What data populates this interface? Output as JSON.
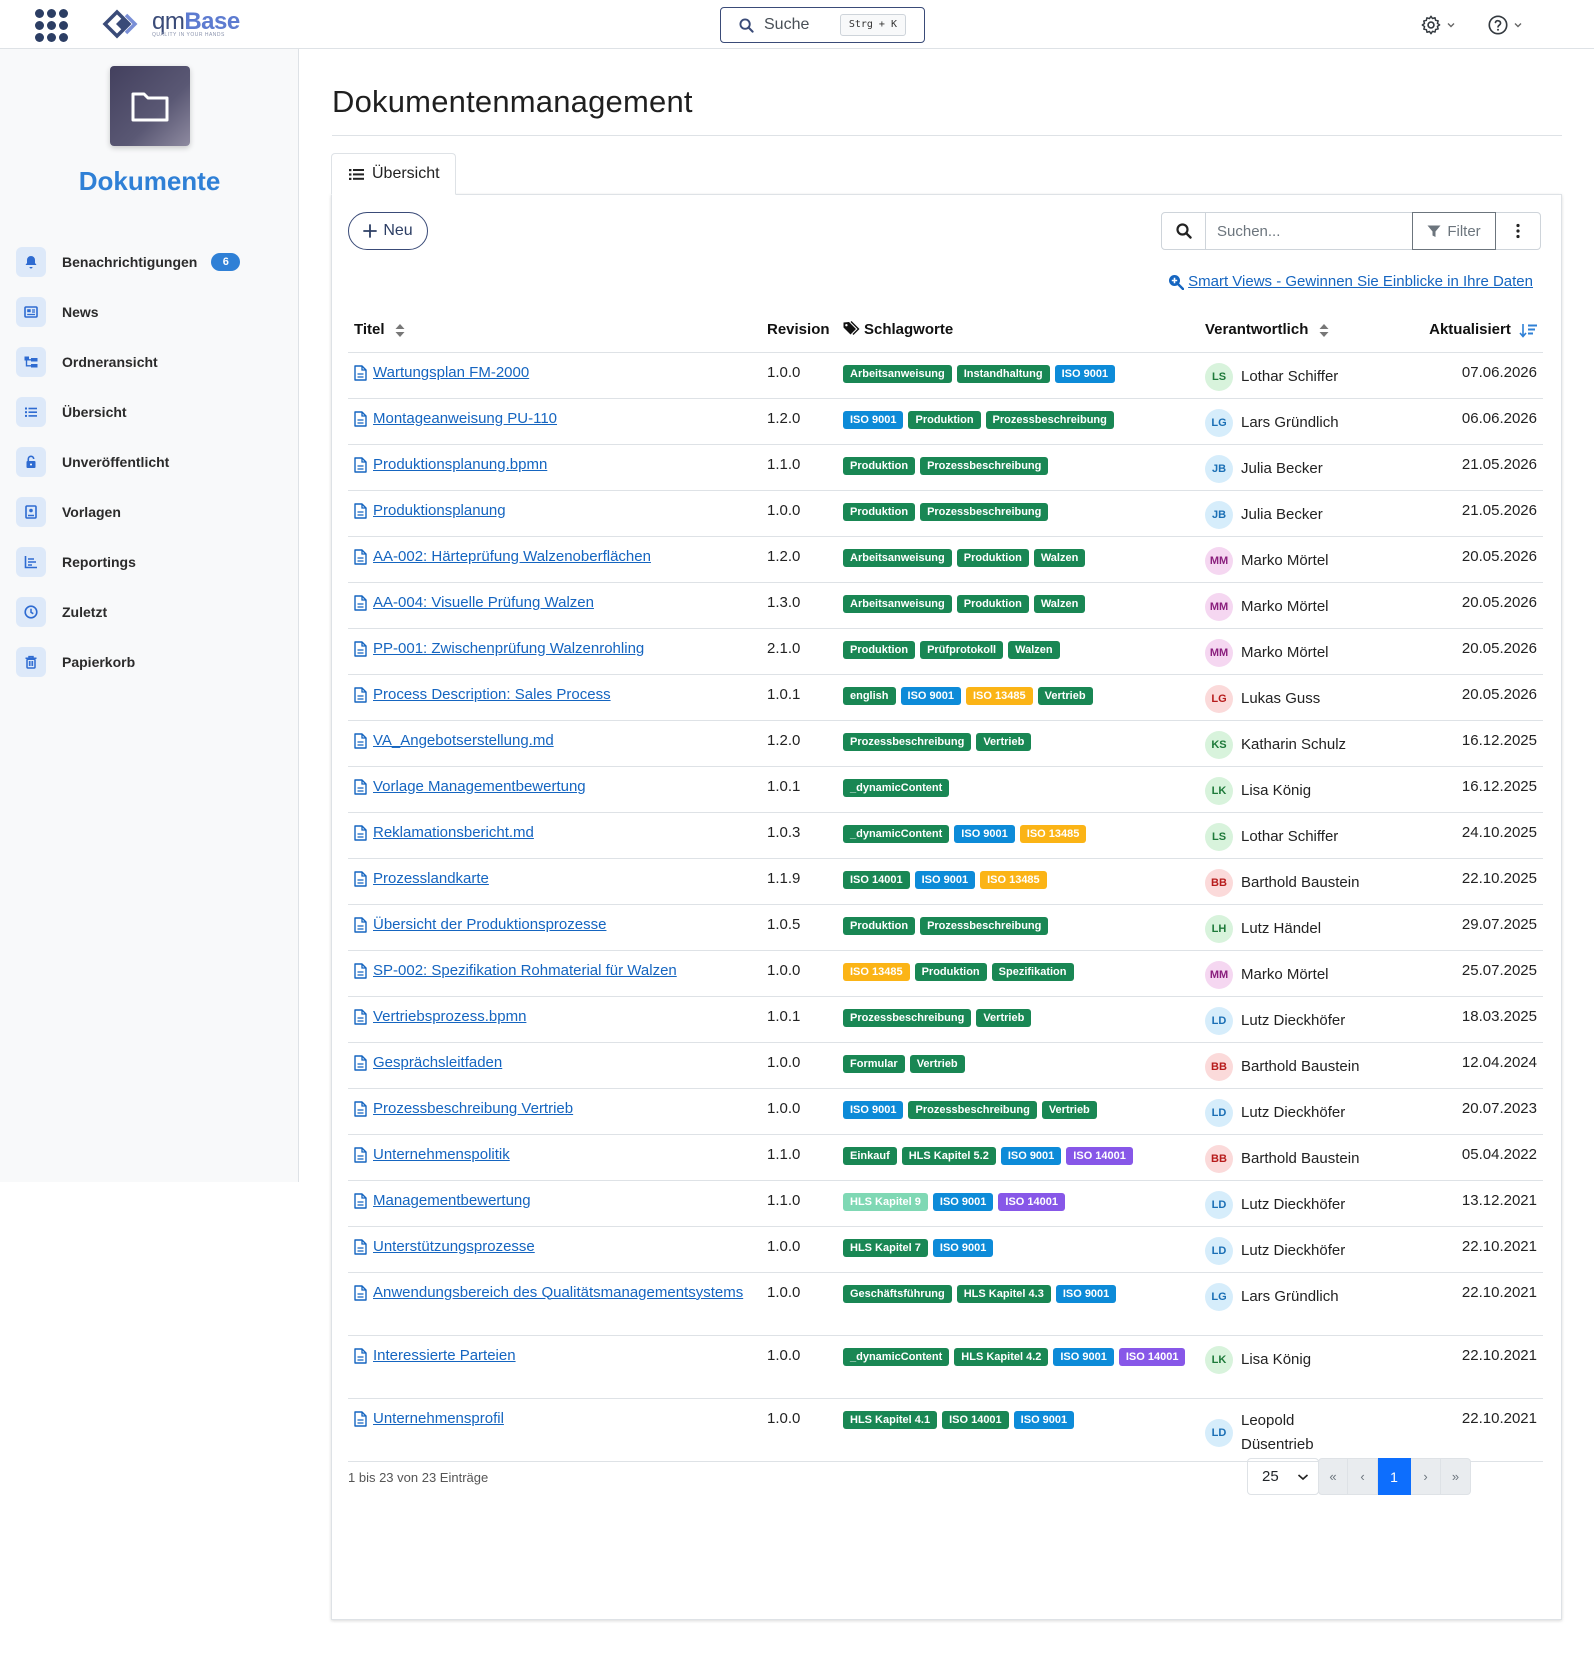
{
  "header": {
    "logo_main": "qm",
    "logo_accent": "Base",
    "logo_sub": "QUALITY IN YOUR HANDS",
    "search_label": "Suche",
    "search_shortcut": "Strg + K"
  },
  "sidebar": {
    "title": "Dokumente",
    "items": [
      {
        "label": "Benachrichtigungen",
        "icon": "bell-icon",
        "badge": "6"
      },
      {
        "label": "News",
        "icon": "newspaper-icon"
      },
      {
        "label": "Ordneransicht",
        "icon": "folder-tree-icon"
      },
      {
        "label": "Übersicht",
        "icon": "list-icon"
      },
      {
        "label": "Unveröffentlicht",
        "icon": "lock-icon"
      },
      {
        "label": "Vorlagen",
        "icon": "template-icon"
      },
      {
        "label": "Reportings",
        "icon": "chart-icon"
      },
      {
        "label": "Zuletzt",
        "icon": "clock-icon"
      },
      {
        "label": "Papierkorb",
        "icon": "trash-icon"
      }
    ]
  },
  "main": {
    "page_title": "Dokumentenmanagement",
    "tab_label": "Übersicht",
    "new_button": "Neu",
    "search_placeholder": "Suchen...",
    "filter_label": "Filter",
    "smart_views_link": "Smart Views - Gewinnen Sie Einblicke in Ihre Daten",
    "columns": {
      "title": "Titel",
      "revision": "Revision",
      "tags": "Schlagworte",
      "owner": "Verantwortlich",
      "updated": "Aktualisiert"
    },
    "tag_colors": {
      "green": "#198754",
      "blue": "#0d8bd8",
      "orange": "#fbb416",
      "purple": "#8757e8",
      "mint": "#7fd8b4"
    },
    "rows": [
      {
        "title": "Wartungsplan FM-2000",
        "rev": "1.0.0",
        "tags": [
          [
            "Arbeitsanweisung",
            "green"
          ],
          [
            "Instandhaltung",
            "green"
          ],
          [
            "ISO 9001",
            "blue"
          ]
        ],
        "initials": "LS",
        "name": "Lothar Schiffer",
        "date": "07.06.2026"
      },
      {
        "title": "Montageanweisung PU-110",
        "rev": "1.2.0",
        "tags": [
          [
            "ISO 9001",
            "blue"
          ],
          [
            "Produktion",
            "green"
          ],
          [
            "Prozessbeschreibung",
            "green"
          ]
        ],
        "initials": "LG",
        "name": "Lars Gründlich",
        "date": "06.06.2026"
      },
      {
        "title": "Produktionsplanung.bpmn",
        "rev": "1.1.0",
        "tags": [
          [
            "Produktion",
            "green"
          ],
          [
            "Prozessbeschreibung",
            "green"
          ]
        ],
        "initials": "JB",
        "name": "Julia Becker",
        "date": "21.05.2026"
      },
      {
        "title": "Produktionsplanung",
        "rev": "1.0.0",
        "tags": [
          [
            "Produktion",
            "green"
          ],
          [
            "Prozessbeschreibung",
            "green"
          ]
        ],
        "initials": "JB",
        "name": "Julia Becker",
        "date": "21.05.2026"
      },
      {
        "title": "AA-002: Härteprüfung Walzenoberflächen",
        "rev": "1.2.0",
        "tags": [
          [
            "Arbeitsanweisung",
            "green"
          ],
          [
            "Produktion",
            "green"
          ],
          [
            "Walzen",
            "green"
          ]
        ],
        "initials": "MM",
        "name": "Marko Mörtel",
        "date": "20.05.2026"
      },
      {
        "title": "AA-004: Visuelle Prüfung Walzen",
        "rev": "1.3.0",
        "tags": [
          [
            "Arbeitsanweisung",
            "green"
          ],
          [
            "Produktion",
            "green"
          ],
          [
            "Walzen",
            "green"
          ]
        ],
        "initials": "MM",
        "name": "Marko Mörtel",
        "date": "20.05.2026"
      },
      {
        "title": "PP-001: Zwischenprüfung Walzenrohling",
        "rev": "2.1.0",
        "tags": [
          [
            "Produktion",
            "green"
          ],
          [
            "Prüfprotokoll",
            "green"
          ],
          [
            "Walzen",
            "green"
          ]
        ],
        "initials": "MM",
        "name": "Marko Mörtel",
        "date": "20.05.2026"
      },
      {
        "title": "Process Description: Sales Process",
        "rev": "1.0.1",
        "tags": [
          [
            "english",
            "green"
          ],
          [
            "ISO 9001",
            "blue"
          ],
          [
            "ISO 13485",
            "orange"
          ],
          [
            "Vertrieb",
            "green"
          ]
        ],
        "initials": "LG",
        "name": "Lukas Guss",
        "date": "20.05.2026"
      },
      {
        "title": "VA_Angebotserstellung.md",
        "rev": "1.2.0",
        "tags": [
          [
            "Prozessbeschreibung",
            "green"
          ],
          [
            "Vertrieb",
            "green"
          ]
        ],
        "initials": "KS",
        "name": "Katharin Schulz",
        "date": "16.12.2025"
      },
      {
        "title": "Vorlage Managementbewertung",
        "rev": "1.0.1",
        "tags": [
          [
            "_dynamicContent",
            "green"
          ]
        ],
        "initials": "LK",
        "name": "Lisa König",
        "date": "16.12.2025"
      },
      {
        "title": "Reklamationsbericht.md",
        "rev": "1.0.3",
        "tags": [
          [
            "_dynamicContent",
            "green"
          ],
          [
            "ISO 9001",
            "blue"
          ],
          [
            "ISO 13485",
            "orange"
          ]
        ],
        "initials": "LS",
        "name": "Lothar Schiffer",
        "date": "24.10.2025"
      },
      {
        "title": "Prozesslandkarte",
        "rev": "1.1.9",
        "tags": [
          [
            "ISO 14001",
            "green"
          ],
          [
            "ISO 9001",
            "blue"
          ],
          [
            "ISO 13485",
            "orange"
          ]
        ],
        "initials": "BB",
        "name": "Barthold Baustein",
        "date": "22.10.2025"
      },
      {
        "title": "Übersicht der Produktionsprozesse",
        "rev": "1.0.5",
        "tags": [
          [
            "Produktion",
            "green"
          ],
          [
            "Prozessbeschreibung",
            "green"
          ]
        ],
        "initials": "LH",
        "name": "Lutz Händel",
        "date": "29.07.2025"
      },
      {
        "title": "SP-002: Spezifikation Rohmaterial für Walzen",
        "rev": "1.0.0",
        "tags": [
          [
            "ISO 13485",
            "orange"
          ],
          [
            "Produktion",
            "green"
          ],
          [
            "Spezifikation",
            "green"
          ]
        ],
        "initials": "MM",
        "name": "Marko Mörtel",
        "date": "25.07.2025"
      },
      {
        "title": "Vertriebsprozess.bpmn",
        "rev": "1.0.1",
        "tags": [
          [
            "Prozessbeschreibung",
            "green"
          ],
          [
            "Vertrieb",
            "green"
          ]
        ],
        "initials": "LD",
        "name": "Lutz Dieckhöfer",
        "date": "18.03.2025"
      },
      {
        "title": "Gesprächsleitfaden",
        "rev": "1.0.0",
        "tags": [
          [
            "Formular",
            "green"
          ],
          [
            "Vertrieb",
            "green"
          ]
        ],
        "initials": "BB",
        "name": "Barthold Baustein",
        "date": "12.04.2024"
      },
      {
        "title": "Prozessbeschreibung Vertrieb",
        "rev": "1.0.0",
        "tags": [
          [
            "ISO 9001",
            "blue"
          ],
          [
            "Prozessbeschreibung",
            "green"
          ],
          [
            "Vertrieb",
            "green"
          ]
        ],
        "initials": "LD",
        "name": "Lutz Dieckhöfer",
        "date": "20.07.2023"
      },
      {
        "title": "Unternehmenspolitik",
        "rev": "1.1.0",
        "tags": [
          [
            "Einkauf",
            "green"
          ],
          [
            "HLS Kapitel 5.2",
            "green"
          ],
          [
            "ISO 9001",
            "blue"
          ],
          [
            "ISO 14001",
            "purple"
          ]
        ],
        "initials": "BB",
        "name": "Barthold Baustein",
        "date": "05.04.2022"
      },
      {
        "title": "Managementbewertung",
        "rev": "1.1.0",
        "tags": [
          [
            "HLS Kapitel 9",
            "mint"
          ],
          [
            "ISO 9001",
            "blue"
          ],
          [
            "ISO 14001",
            "purple"
          ]
        ],
        "initials": "LD",
        "name": "Lutz Dieckhöfer",
        "date": "13.12.2021"
      },
      {
        "title": "Unterstützungsprozesse",
        "rev": "1.0.0",
        "tags": [
          [
            "HLS Kapitel 7",
            "green"
          ],
          [
            "ISO 9001",
            "blue"
          ]
        ],
        "initials": "LD",
        "name": "Lutz Dieckhöfer",
        "date": "22.10.2021"
      },
      {
        "title": "Anwendungsbereich des Qualitätsmanagementsystems",
        "rev": "1.0.0",
        "tags": [
          [
            "Geschäftsführung",
            "green"
          ],
          [
            "HLS Kapitel 4.3",
            "green"
          ],
          [
            "ISO 9001",
            "blue"
          ]
        ],
        "initials": "LG",
        "name": "Lars Gründlich",
        "date": "22.10.2021",
        "tall": true
      },
      {
        "title": "Interessierte Parteien",
        "rev": "1.0.0",
        "tags": [
          [
            "_dynamicContent",
            "green"
          ],
          [
            "HLS Kapitel 4.2",
            "green"
          ],
          [
            "ISO 9001",
            "blue"
          ],
          [
            "ISO 14001",
            "purple"
          ]
        ],
        "initials": "LK",
        "name": "Lisa König",
        "date": "22.10.2021",
        "tall": true
      },
      {
        "title": "Unternehmensprofil",
        "rev": "1.0.0",
        "tags": [
          [
            "HLS Kapitel 4.1",
            "green"
          ],
          [
            "ISO 14001",
            "green"
          ],
          [
            "ISO 9001",
            "blue"
          ]
        ],
        "initials": "LD",
        "name": "Leopold Düsentrieb",
        "date": "22.10.2021",
        "tall": true
      }
    ],
    "footer_info": "1 bis 23 von 23 Einträge",
    "page_size": "25",
    "pager": [
      "«",
      "‹",
      "1",
      "›",
      "»"
    ],
    "current_page": "1"
  }
}
